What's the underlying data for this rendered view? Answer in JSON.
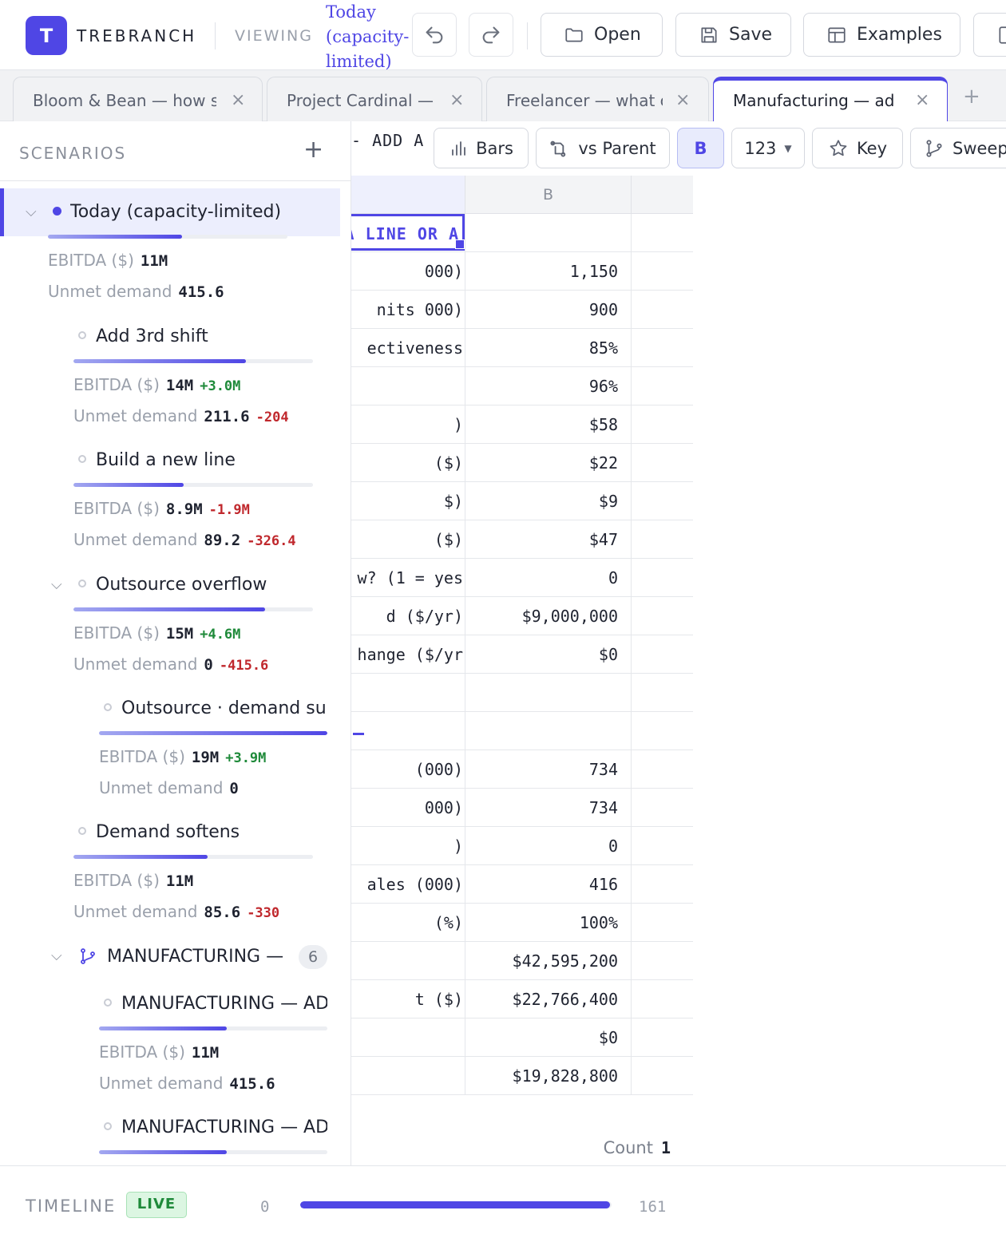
{
  "app": {
    "logo_letter": "T",
    "brand": "TREBRANCH"
  },
  "header": {
    "viewing_label": "VIEWING",
    "viewing_value": "Today (capacity-limited)",
    "undo_icon": "undo-icon",
    "redo_icon": "redo-icon",
    "buttons": {
      "open": "Open",
      "save": "Save",
      "examples": "Examples"
    }
  },
  "tabs": [
    {
      "label": "Bloom & Bean — how s",
      "active": false
    },
    {
      "label": "Project Cardinal —",
      "active": false
    },
    {
      "label": "Freelancer — what c",
      "active": false
    },
    {
      "label": "Manufacturing — ad",
      "active": true
    }
  ],
  "sheet_toolbar": {
    "title_fragment": "- ADD A",
    "buttons": {
      "bars": "Bars",
      "vs_parent": "vs Parent",
      "b": "B",
      "format": "123",
      "key": "Key",
      "sweep": "Sweep"
    }
  },
  "grid": {
    "columns": [
      "",
      "B"
    ],
    "selected_cell_text": "A LINE OR A",
    "rows": [
      {
        "a": "",
        "b": ""
      },
      {
        "a": "000)",
        "b": "1,150"
      },
      {
        "a": "nits 000)",
        "b": "900"
      },
      {
        "a": "ectiveness",
        "b": "85%"
      },
      {
        "a": "",
        "b": "96%"
      },
      {
        "a": ")",
        "b": "$58"
      },
      {
        "a": "($)",
        "b": "$22"
      },
      {
        "a": "$)",
        "b": "$9"
      },
      {
        "a": " ($)",
        "b": "$47"
      },
      {
        "a": "w? (1 = yes",
        "b": "0"
      },
      {
        "a": "d ($/yr)",
        "b": "$9,000,000"
      },
      {
        "a": "hange ($/yr",
        "b": "$0"
      },
      {
        "a": "",
        "b": ""
      },
      {
        "a": "",
        "b": ""
      },
      {
        "a": " (000)",
        "b": "734"
      },
      {
        "a": "000)",
        "b": "734"
      },
      {
        "a": ")",
        "b": "0"
      },
      {
        "a": "ales (000)",
        "b": "416"
      },
      {
        "a": "(%)",
        "b": "100%"
      },
      {
        "a": "",
        "b": "$42,595,200"
      },
      {
        "a": "t ($)",
        "b": "$22,766,400"
      },
      {
        "a": "",
        "b": "$0"
      },
      {
        "a": "",
        "b": "$19,828,800"
      }
    ],
    "status": {
      "count_label": "Count",
      "count_value": "1"
    }
  },
  "sidebar": {
    "heading": "SCENARIOS",
    "scenarios": [
      {
        "title": "Today (capacity-limited)",
        "active": true,
        "progress": 0.56,
        "ebitda_label": "EBITDA ($)",
        "ebitda": "11M",
        "ebitda_delta": "",
        "unmet_label": "Unmet demand",
        "unmet": "415.6",
        "unmet_delta": ""
      },
      {
        "title": "Add 3rd shift",
        "progress": 0.72,
        "ebitda_label": "EBITDA ($)",
        "ebitda": "14M",
        "ebitda_delta": "+3.0M",
        "unmet_label": "Unmet demand",
        "unmet": "211.6",
        "unmet_delta": "-204"
      },
      {
        "title": "Build a new line",
        "progress": 0.46,
        "ebitda_label": "EBITDA ($)",
        "ebitda": "8.9M",
        "ebitda_delta": "-1.9M",
        "unmet_label": "Unmet demand",
        "unmet": "89.2",
        "unmet_delta": "-326.4"
      },
      {
        "title": "Outsource overflow",
        "progress": 0.8,
        "ebitda_label": "EBITDA ($)",
        "ebitda": "15M",
        "ebitda_delta": "+4.6M",
        "unmet_label": "Unmet demand",
        "unmet": "0",
        "unmet_delta": "-415.6"
      },
      {
        "title": "Outsource · demand surg",
        "progress": 1.0,
        "ebitda_label": "EBITDA ($)",
        "ebitda": "19M",
        "ebitda_delta": "+3.9M",
        "unmet_label": "Unmet demand",
        "unmet": "0",
        "unmet_delta": ""
      },
      {
        "title": "Demand softens",
        "progress": 0.56,
        "ebitda_label": "EBITDA ($)",
        "ebitda": "11M",
        "ebitda_delta": "",
        "unmet_label": "Unmet demand",
        "unmet": "85.6",
        "unmet_delta": "-330"
      },
      {
        "title": "MANUFACTURING —",
        "group": true,
        "count": "6"
      },
      {
        "title": "MANUFACTURING — AD",
        "progress": 0.56,
        "ebitda_label": "EBITDA ($)",
        "ebitda": "11M",
        "ebitda_delta": "",
        "unmet_label": "Unmet demand",
        "unmet": "415.6",
        "unmet_delta": ""
      },
      {
        "title": "MANUFACTURING — AD",
        "progress": 0.56
      }
    ]
  },
  "timeline": {
    "label": "TIMELINE",
    "live": "LIVE",
    "min": "0",
    "max": "161",
    "position": 1.0
  },
  "colors": {
    "accent": "#4f46e5",
    "positive": "#1f8a3a",
    "negative": "#c0282d",
    "live_bg": "#dcf6e2"
  }
}
